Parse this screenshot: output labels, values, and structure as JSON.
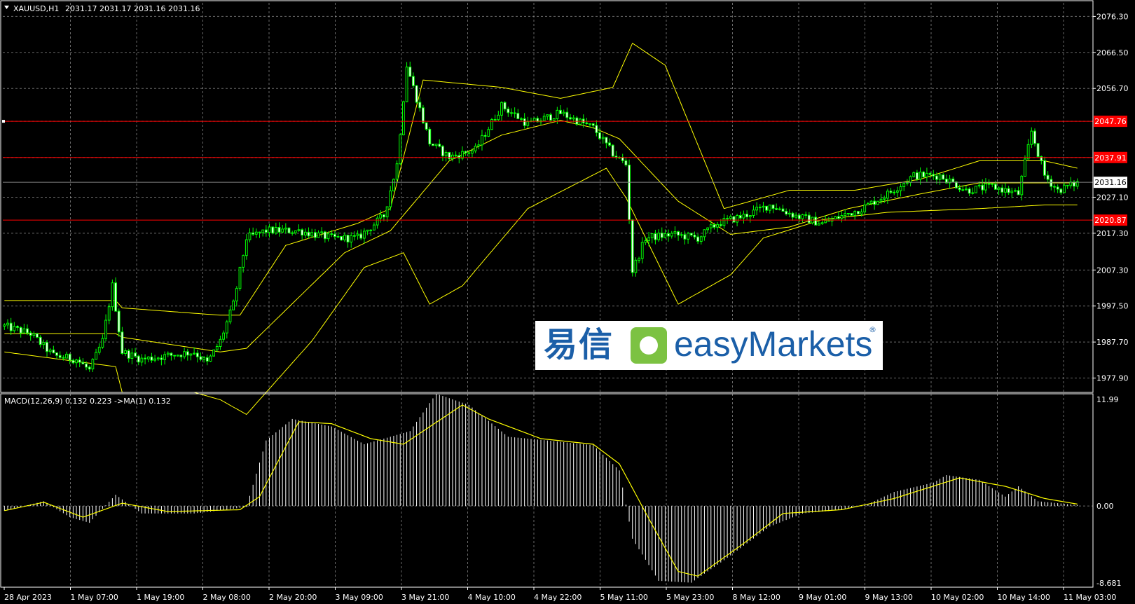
{
  "header": {
    "symbol": "XAUUSD,H1",
    "ohlc": "2031.17 2031.17 2031.16 2031.16",
    "macd_label": "MACD(12,26,9) 0.132 0.223  ->MA(1) 0.132"
  },
  "colors": {
    "background": "#000000",
    "grid": "#c0c0c0",
    "bull": "#00ff00",
    "bear": "#ffffff",
    "band": "#ffff00",
    "level": "#ff0000",
    "histogram": "#ffffff",
    "signal": "#ffff00"
  },
  "logo": {
    "cn": "易信",
    "en": "easyMarkets"
  },
  "chart_data": [
    {
      "type": "candlestick",
      "title": "XAUUSD,H1",
      "y_ticks": [
        "2076.30",
        "2066.50",
        "2056.70",
        "2047.76",
        "2037.91",
        "2031.16",
        "2027.10",
        "2020.87",
        "2017.30",
        "2007.30",
        "1997.50",
        "1987.70",
        "1977.90"
      ],
      "ylim": [
        1974,
        2080
      ],
      "x_ticks": [
        "28 Apr 2023",
        "1 May 07:00",
        "1 May 19:00",
        "2 May 08:00",
        "2 May 20:00",
        "3 May 09:00",
        "3 May 21:00",
        "4 May 10:00",
        "4 May 22:00",
        "5 May 11:00",
        "5 May 23:00",
        "8 May 12:00",
        "9 May 01:00",
        "9 May 13:00",
        "10 May 02:00",
        "10 May 14:00",
        "11 May 03:00"
      ],
      "levels": [
        {
          "label": "2047.76",
          "value": 2047.76,
          "color": "#ff0000"
        },
        {
          "label": "2037.91",
          "value": 2037.91,
          "color": "#ff0000"
        },
        {
          "label": "2020.87",
          "value": 2020.87,
          "color": "#ff0000"
        }
      ],
      "last_price": {
        "label": "2031.16",
        "value": 2031.16
      },
      "price_anchors": [
        [
          0,
          1992
        ],
        [
          8,
          1990
        ],
        [
          15,
          1984
        ],
        [
          22,
          1983
        ],
        [
          26,
          1980
        ],
        [
          30,
          1988
        ],
        [
          33,
          2003
        ],
        [
          36,
          1985
        ],
        [
          42,
          1983
        ],
        [
          50,
          1984
        ],
        [
          58,
          1985
        ],
        [
          62,
          1982
        ],
        [
          66,
          1988
        ],
        [
          70,
          1998
        ],
        [
          74,
          2016
        ],
        [
          80,
          2018
        ],
        [
          90,
          2018
        ],
        [
          100,
          2016
        ],
        [
          108,
          2016
        ],
        [
          116,
          2022
        ],
        [
          120,
          2036
        ],
        [
          123,
          2063
        ],
        [
          126,
          2054
        ],
        [
          130,
          2042
        ],
        [
          136,
          2038
        ],
        [
          144,
          2040
        ],
        [
          152,
          2052
        ],
        [
          160,
          2047
        ],
        [
          170,
          2050
        ],
        [
          180,
          2046
        ],
        [
          186,
          2039
        ],
        [
          190,
          2036
        ],
        [
          192,
          2007
        ],
        [
          196,
          2016
        ],
        [
          204,
          2017
        ],
        [
          212,
          2016
        ],
        [
          218,
          2020
        ],
        [
          226,
          2022
        ],
        [
          234,
          2025
        ],
        [
          242,
          2022
        ],
        [
          250,
          2020
        ],
        [
          256,
          2022
        ],
        [
          262,
          2024
        ],
        [
          270,
          2028
        ],
        [
          278,
          2033
        ],
        [
          286,
          2033
        ],
        [
          294,
          2029
        ],
        [
          302,
          2030
        ],
        [
          310,
          2028
        ],
        [
          314,
          2045
        ],
        [
          318,
          2033
        ],
        [
          322,
          2029
        ],
        [
          328,
          2031
        ]
      ],
      "upper_band_anchors": [
        [
          0,
          1999
        ],
        [
          34,
          1999
        ],
        [
          36,
          1997
        ],
        [
          66,
          1995
        ],
        [
          72,
          1995
        ],
        [
          86,
          2014
        ],
        [
          108,
          2020
        ],
        [
          118,
          2024
        ],
        [
          128,
          2059
        ],
        [
          152,
          2057
        ],
        [
          170,
          2054
        ],
        [
          186,
          2057
        ],
        [
          192,
          2069
        ],
        [
          202,
          2063
        ],
        [
          220,
          2024
        ],
        [
          240,
          2029
        ],
        [
          260,
          2029
        ],
        [
          280,
          2032
        ],
        [
          298,
          2037
        ],
        [
          310,
          2037
        ],
        [
          318,
          2037
        ],
        [
          328,
          2035
        ]
      ],
      "middle_band_anchors": [
        [
          0,
          1990
        ],
        [
          34,
          1990
        ],
        [
          36,
          1989
        ],
        [
          66,
          1985
        ],
        [
          74,
          1986
        ],
        [
          104,
          2012
        ],
        [
          118,
          2018
        ],
        [
          136,
          2037
        ],
        [
          152,
          2044
        ],
        [
          170,
          2048
        ],
        [
          180,
          2046
        ],
        [
          188,
          2043
        ],
        [
          206,
          2026
        ],
        [
          222,
          2017
        ],
        [
          240,
          2019
        ],
        [
          258,
          2024
        ],
        [
          280,
          2028
        ],
        [
          298,
          2031
        ],
        [
          318,
          2031
        ],
        [
          328,
          2031
        ]
      ],
      "lower_band_anchors": [
        [
          0,
          1985
        ],
        [
          34,
          1981
        ],
        [
          36,
          1974
        ],
        [
          58,
          1974
        ],
        [
          66,
          1972
        ],
        [
          74,
          1968
        ],
        [
          94,
          1988
        ],
        [
          110,
          2008
        ],
        [
          122,
          2012
        ],
        [
          130,
          1998
        ],
        [
          140,
          2003
        ],
        [
          160,
          2024
        ],
        [
          184,
          2035
        ],
        [
          190,
          2027
        ],
        [
          206,
          1998
        ],
        [
          222,
          2006
        ],
        [
          232,
          2016
        ],
        [
          250,
          2021
        ],
        [
          270,
          2023
        ],
        [
          298,
          2024
        ],
        [
          318,
          2025
        ],
        [
          328,
          2025
        ]
      ],
      "bar_count": 329
    },
    {
      "type": "macd",
      "title": "MACD(12,26,9) 0.132 0.223  ->MA(1) 0.132",
      "y_ticks": [
        "11.99",
        "0.00",
        "-8.681"
      ],
      "ylim": [
        -8.681,
        11.99
      ],
      "macd_anchors": [
        [
          0,
          -0.5
        ],
        [
          12,
          0.5
        ],
        [
          20,
          -1.2
        ],
        [
          26,
          -1.8
        ],
        [
          34,
          1.2
        ],
        [
          42,
          -0.8
        ],
        [
          58,
          -0.8
        ],
        [
          68,
          -0.4
        ],
        [
          74,
          -0.1
        ],
        [
          80,
          7.0
        ],
        [
          88,
          9.3
        ],
        [
          100,
          8.5
        ],
        [
          110,
          6.6
        ],
        [
          124,
          8.0
        ],
        [
          132,
          12.0
        ],
        [
          142,
          10.8
        ],
        [
          154,
          7.4
        ],
        [
          166,
          7.0
        ],
        [
          180,
          6.5
        ],
        [
          188,
          3.8
        ],
        [
          192,
          -3.5
        ],
        [
          200,
          -8.0
        ],
        [
          210,
          -8.2
        ],
        [
          220,
          -5.8
        ],
        [
          234,
          -2.2
        ],
        [
          244,
          -0.8
        ],
        [
          256,
          -0.4
        ],
        [
          264,
          0.2
        ],
        [
          272,
          1.5
        ],
        [
          284,
          2.5
        ],
        [
          288,
          3.3
        ],
        [
          298,
          2.8
        ],
        [
          306,
          1.0
        ],
        [
          310,
          2.1
        ],
        [
          316,
          0.5
        ],
        [
          328,
          0.1
        ]
      ],
      "signal_anchors": [
        [
          0,
          -0.5
        ],
        [
          12,
          0.4
        ],
        [
          24,
          -1.2
        ],
        [
          36,
          0.3
        ],
        [
          50,
          -0.6
        ],
        [
          72,
          -0.4
        ],
        [
          78,
          1.0
        ],
        [
          90,
          9.0
        ],
        [
          100,
          8.8
        ],
        [
          112,
          7.2
        ],
        [
          122,
          6.6
        ],
        [
          140,
          10.8
        ],
        [
          148,
          9.3
        ],
        [
          164,
          7.2
        ],
        [
          180,
          6.6
        ],
        [
          188,
          4.5
        ],
        [
          198,
          -2.0
        ],
        [
          206,
          -7.0
        ],
        [
          212,
          -7.5
        ],
        [
          226,
          -4.0
        ],
        [
          238,
          -0.8
        ],
        [
          256,
          -0.4
        ],
        [
          272,
          0.8
        ],
        [
          292,
          3.0
        ],
        [
          306,
          2.1
        ],
        [
          318,
          0.8
        ],
        [
          328,
          0.2
        ]
      ]
    }
  ]
}
